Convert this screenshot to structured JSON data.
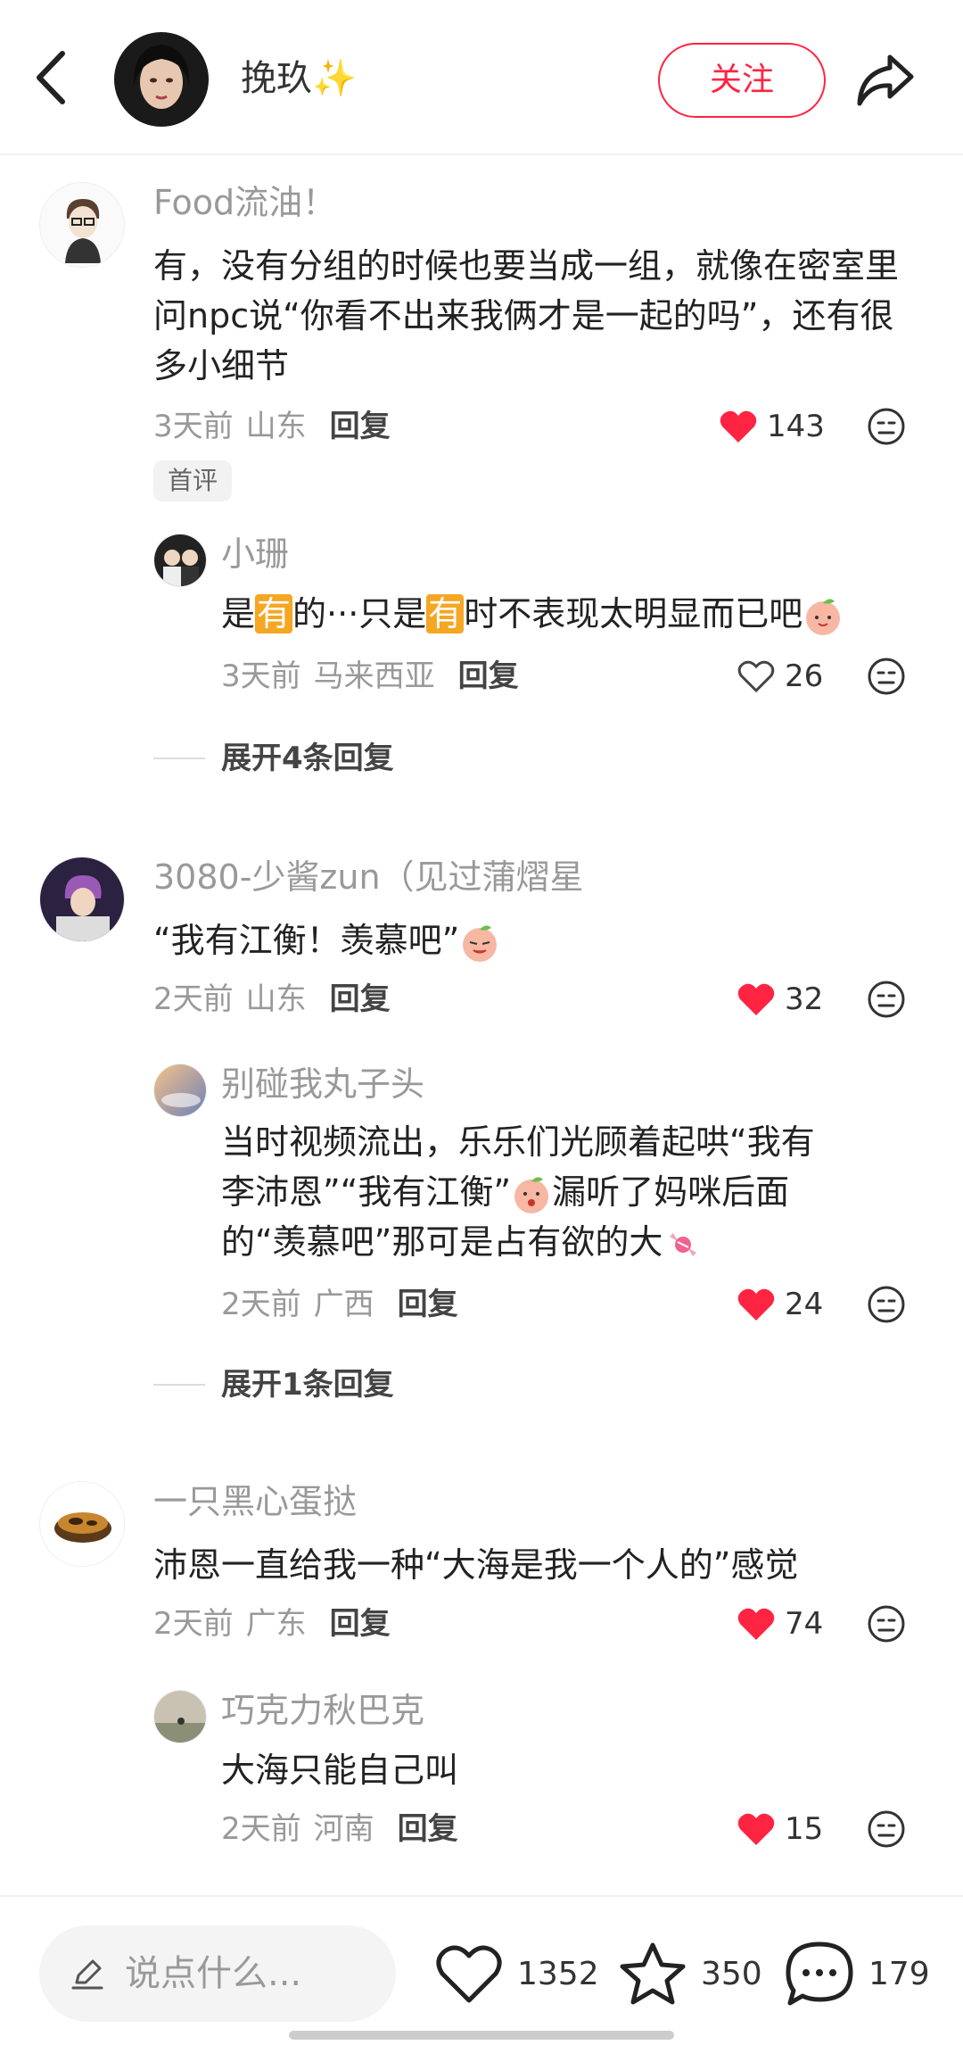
{
  "header": {
    "author_name": "挽玖",
    "author_sparkle": "✨",
    "follow_label": "关注"
  },
  "comments": [
    {
      "user": "Food流油！",
      "text": "有，没有分组的时候也要当成一组，就像在密室里问npc说“你看不出来我俩才是一起的吗”，还有很多小细节",
      "time": "3天前",
      "location": "山东",
      "reply_label": "回复",
      "likes": "143",
      "liked": true,
      "tag": "首评",
      "replies": [
        {
          "user": "小珊",
          "text_parts": [
            "是",
            "有",
            "的···只是",
            "有",
            "时不表现太明显而已吧"
          ],
          "time": "3天前",
          "location": "马来西亚",
          "reply_label": "回复",
          "likes": "26",
          "liked": false
        }
      ],
      "expand_label": "展开4条回复"
    },
    {
      "user": "3080-少酱zun（见过蒲熠星",
      "text": "“我有江衡！羡慕吧”",
      "time": "2天前",
      "location": "山东",
      "reply_label": "回复",
      "likes": "32",
      "liked": true,
      "replies": [
        {
          "user": "别碰我丸子头",
          "text_line1": "当时视频流出，乐乐们光顾着起哄“我有",
          "text_line2a": "李沛恩”“我有江衡”",
          "text_line2b": "漏听了妈咪后面",
          "text_line3": "的“羡慕吧”那可是占有欲的大",
          "time": "2天前",
          "location": "广西",
          "reply_label": "回复",
          "likes": "24",
          "liked": true
        }
      ],
      "expand_label": "展开1条回复"
    },
    {
      "user": "一只黑心蛋挞",
      "text": "沛恩一直给我一种“大海是我一个人的”感觉",
      "time": "2天前",
      "location": "广东",
      "reply_label": "回复",
      "likes": "74",
      "liked": true,
      "replies": [
        {
          "user": "巧克力秋巴克",
          "text": "大海只能自己叫",
          "time": "2天前",
          "location": "河南",
          "reply_label": "回复",
          "likes": "15",
          "liked": true
        }
      ]
    }
  ],
  "bottom_bar": {
    "input_placeholder": "说点什么...",
    "like_count": "1352",
    "collect_count": "350",
    "comment_count": "179"
  },
  "colors": {
    "accent": "#ff2442",
    "highlight": "#f5a623"
  }
}
